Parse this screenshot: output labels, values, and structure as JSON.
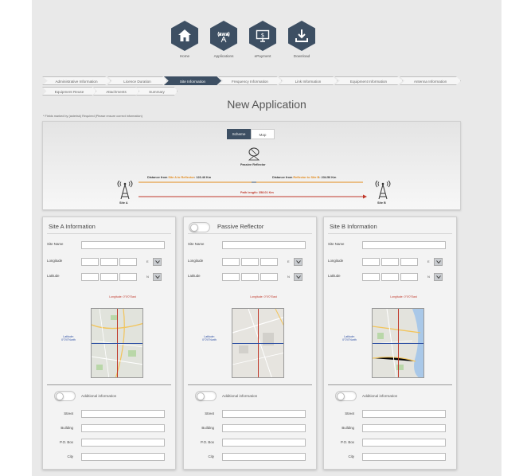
{
  "nav": {
    "items": [
      {
        "label": "Home",
        "icon": "home-icon"
      },
      {
        "label": "Applications",
        "icon": "antenna-icon"
      },
      {
        "label": "ePayment",
        "icon": "payment-icon"
      },
      {
        "label": "Download",
        "icon": "download-icon"
      }
    ],
    "tower_glyph": "AWA",
    "payment_glyph": "$"
  },
  "steps": {
    "row1": [
      "Administrative Information",
      "Licence Duration",
      "Site Information",
      "Frequency Information",
      "Link Information",
      "Equipment Information",
      "Antenna Information"
    ],
    "row2": [
      "Equipment Reuse",
      "Attachments",
      "Summary"
    ],
    "active": "Site Information"
  },
  "page": {
    "title": "New Application",
    "note": "* Fields marked by (asterisk) Required (Please ensure correct information)"
  },
  "scheme": {
    "tab_scheme": "Scheme",
    "tab_map": "Map",
    "reflector_label": "Passive Reflector",
    "dist_a_prefix": "Distance from ",
    "dist_a_site": "Site A to Reflector",
    "dist_a_value": ": 123.46 Km",
    "dist_b_prefix": "Distance from ",
    "dist_b_site": "Reflector to Site B",
    "dist_b_value": ": 234.56 Km",
    "path_length": "Path length: 358.01 Km",
    "site_a": "Site A",
    "site_b": "Site B"
  },
  "form": {
    "site_name_label": "Site Name",
    "longitude_label": "Longitude",
    "latitude_label": "Latitude",
    "lon_dir": "E",
    "lat_dir": "N",
    "additional_label": "Additional information",
    "street_label": "Street",
    "building_label": "Building",
    "pobox_label": "P.O. Box",
    "city_label": "City"
  },
  "cards": [
    {
      "title": "Site A Information",
      "lon_readout": "Longitude: 0°0'0\"East",
      "lat_readout": "Latitude: 0°0'0\"North"
    },
    {
      "title": "Passive Reflector",
      "lon_readout": "Longitude: 0°0'0\"East",
      "lat_readout": "Latitude: 0°0'0\"North"
    },
    {
      "title": "Site B Information",
      "lon_readout": "Longitude: 0°0'0\"East",
      "lat_readout": "Latitude: 0°0'0\"North"
    }
  ],
  "colors": {
    "nav": "#3d4f63",
    "distance_orange": "#e28a1c",
    "path_red": "#c0392b",
    "map_blue": "#2d4fa3"
  }
}
